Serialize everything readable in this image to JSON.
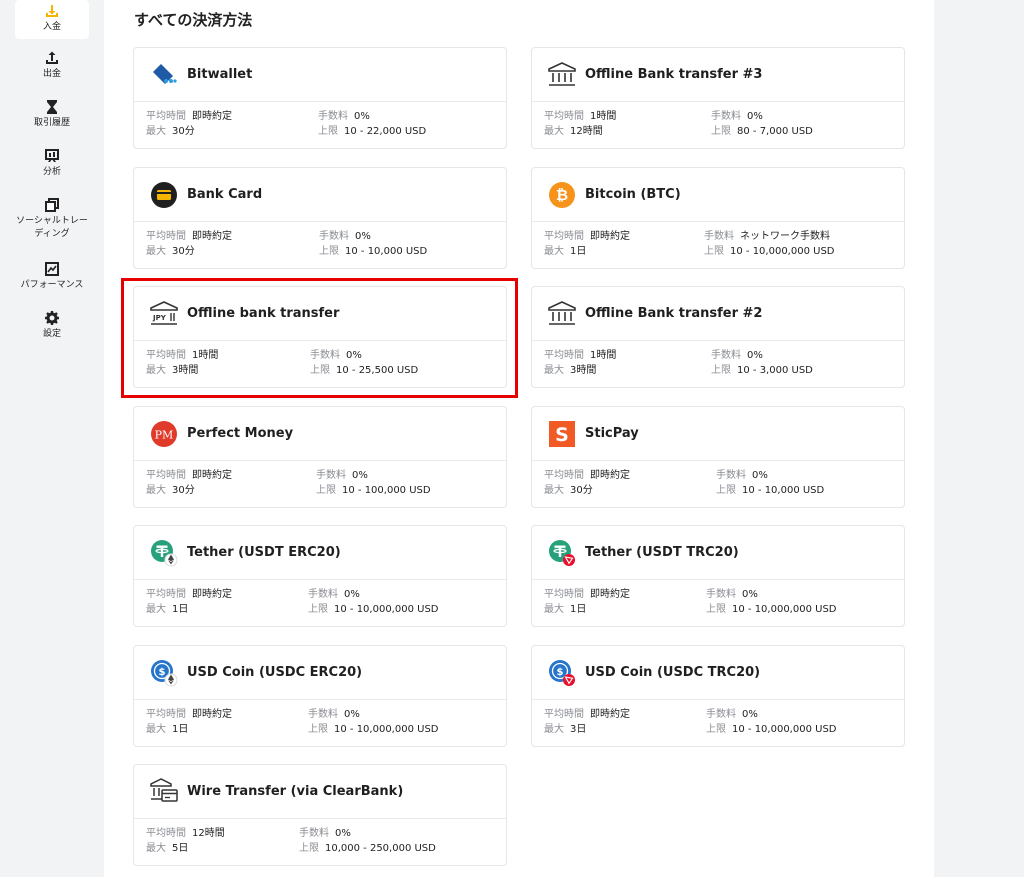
{
  "sidebar": {
    "items": [
      {
        "label": "入金",
        "icon": "download-icon",
        "active": true
      },
      {
        "label": "出金",
        "icon": "upload-icon"
      },
      {
        "label": "取引履歴",
        "icon": "hourglass-icon"
      },
      {
        "label": "分析",
        "icon": "chart-board-icon"
      },
      {
        "label": "ソーシャルトレーディング",
        "icon": "copy-icon"
      },
      {
        "label": "パフォーマンス",
        "icon": "performance-chart-icon"
      },
      {
        "label": "設定",
        "icon": "gear-icon"
      }
    ]
  },
  "section_title": "すべての決済方法",
  "labels": {
    "avg_time": "平均時間",
    "max": "最大",
    "fee": "手数料",
    "limit": "上限"
  },
  "methods": [
    {
      "name": "Bitwallet",
      "icon": "bitwallet-icon",
      "avg": "即時約定",
      "max": "30分",
      "fee": "0%",
      "limit": "10 - 22,000 USD"
    },
    {
      "name": "Offline Bank transfer #3",
      "icon": "bank-icon",
      "avg": "1時間",
      "max": "12時間",
      "fee": "0%",
      "limit": "80 - 7,000 USD"
    },
    {
      "name": "Bank Card",
      "icon": "bank-card-icon",
      "avg": "即時約定",
      "max": "30分",
      "fee": "0%",
      "limit": "10 - 10,000 USD"
    },
    {
      "name": "Bitcoin (BTC)",
      "icon": "bitcoin-icon",
      "avg": "即時約定",
      "max": "1日",
      "fee": "ネットワーク手数料",
      "limit": "10 - 10,000,000 USD"
    },
    {
      "name": "Offline bank transfer",
      "icon": "jpy-bank-icon",
      "avg": "1時間",
      "max": "3時間",
      "fee": "0%",
      "limit": "10 - 25,500 USD",
      "jpy_text": "JPY"
    },
    {
      "name": "Offline Bank transfer #2",
      "icon": "bank-icon",
      "avg": "1時間",
      "max": "3時間",
      "fee": "0%",
      "limit": "10 - 3,000 USD"
    },
    {
      "name": "Perfect Money",
      "icon": "perfect-money-icon",
      "avg": "即時約定",
      "max": "30分",
      "fee": "0%",
      "limit": "10 - 100,000 USD",
      "pm_text": "PM"
    },
    {
      "name": "SticPay",
      "icon": "sticpay-icon",
      "avg": "即時約定",
      "max": "30分",
      "fee": "0%",
      "limit": "10 - 10,000 USD",
      "s_text": "S"
    },
    {
      "name": "Tether (USDT ERC20)",
      "icon": "tether-erc20-icon",
      "avg": "即時約定",
      "max": "1日",
      "fee": "0%",
      "limit": "10 - 10,000,000 USD"
    },
    {
      "name": "Tether (USDT TRC20)",
      "icon": "tether-trc20-icon",
      "avg": "即時約定",
      "max": "1日",
      "fee": "0%",
      "limit": "10 - 10,000,000 USD"
    },
    {
      "name": "USD Coin (USDC ERC20)",
      "icon": "usdc-erc20-icon",
      "avg": "即時約定",
      "max": "1日",
      "fee": "0%",
      "limit": "10 - 10,000,000 USD"
    },
    {
      "name": "USD Coin (USDC TRC20)",
      "icon": "usdc-trc20-icon",
      "avg": "即時約定",
      "max": "3日",
      "fee": "0%",
      "limit": "10 - 10,000,000 USD"
    },
    {
      "name": "Wire Transfer (via ClearBank)",
      "icon": "wire-transfer-icon",
      "avg": "12時間",
      "max": "5日",
      "fee": "0%",
      "limit": "10,000 - 250,000 USD"
    }
  ],
  "colors": {
    "accent": "#f5b400",
    "highlight": "#e60000",
    "tether": "#26a17b",
    "usdc": "#2775ca",
    "bitcoin": "#f7931a",
    "perfect_money": "#e03a2a",
    "sticpay": "#f15a24",
    "bitwallet": "#1f5aa6"
  }
}
